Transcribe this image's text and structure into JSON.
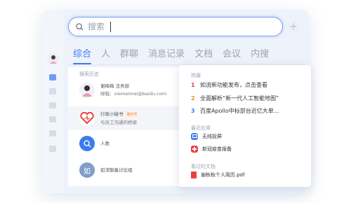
{
  "search": {
    "placeholder": "搜索"
  },
  "plus_label": "+",
  "tabs": [
    {
      "label": "综合",
      "active": true
    },
    {
      "label": "人"
    },
    {
      "label": "群聊"
    },
    {
      "label": "消息记录"
    },
    {
      "label": "文档"
    },
    {
      "label": "会议"
    },
    {
      "label": "内搜"
    }
  ],
  "history": {
    "title": "搜索历史",
    "items": [
      {
        "line1": "谢梅梅 法务部",
        "line2": "邮箱：xiemeimei@baidu.com",
        "icon": "user-avatar"
      },
      {
        "line1": "行政小秘书",
        "tag": "服务号",
        "line2": "与员工沟通的桥梁",
        "icon": "heart-logo-icon"
      },
      {
        "line1": "人数",
        "icon": "search-icon"
      },
      {
        "line1": "如流製备讨论组",
        "avatar_text": "如",
        "icon": "group-avatar"
      }
    ]
  },
  "hot": {
    "title": "热搜",
    "items": [
      {
        "rank": "1",
        "text": "如流新功能发布，点击查看",
        "color": "#e8423f"
      },
      {
        "rank": "2",
        "text": "全面解析“新一代人工智能地图”",
        "color": "#f08c2e"
      },
      {
        "rank": "3",
        "text": "百度Apollo中标部台近亿大单...",
        "color": "#3b7bf0"
      }
    ]
  },
  "recent_apps": {
    "title": "最近应用",
    "items": [
      {
        "text": "无线投屏",
        "icon": "cast-screen-icon",
        "color": "#4f7ef0"
      },
      {
        "text": "新冠疫苗报备",
        "icon": "vaccine-icon",
        "color": "#e8423f"
      }
    ]
  },
  "viewed_docs": {
    "title": "看过的文档",
    "items": [
      {
        "text": "谢秋秋个人简历.pdf",
        "icon": "pdf-file-icon",
        "color": "#e8423f"
      }
    ]
  }
}
